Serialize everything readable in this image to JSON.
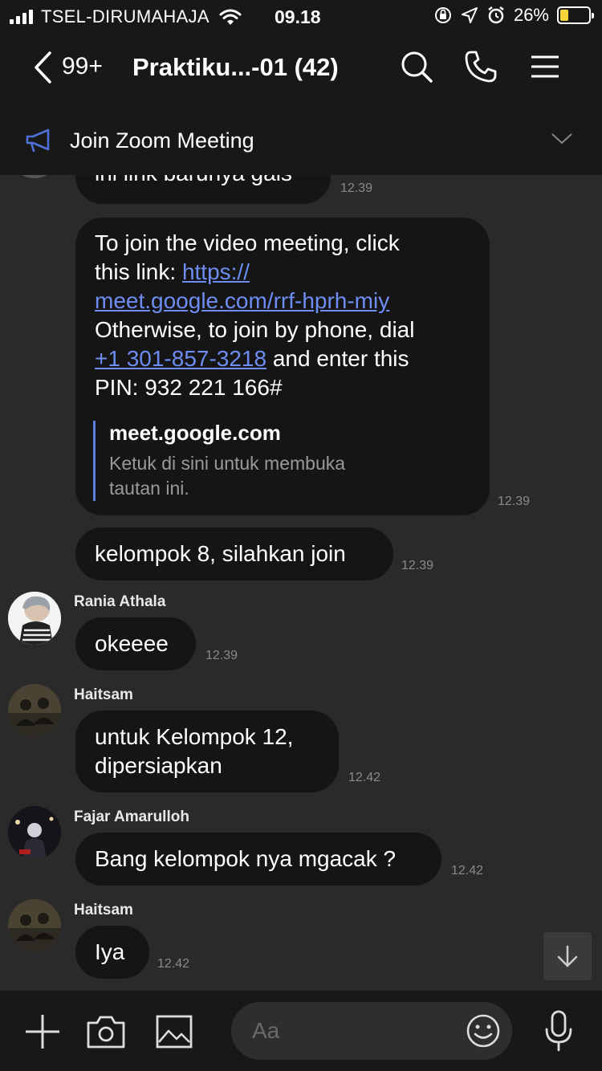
{
  "status_bar": {
    "carrier": "TSEL-DIRUMAHAJA",
    "time": "09.18",
    "battery": "26%"
  },
  "header": {
    "unread_count": "99+",
    "title": "Praktiku...-01 (42)"
  },
  "announcement": {
    "text": "Join Zoom Meeting"
  },
  "messages": [
    {
      "text": "ini link barunya gais",
      "time": "12.39"
    },
    {
      "line1": "To join the video meeting, click",
      "line2_prefix": "this link: ",
      "link1": "https://",
      "link2": "meet.google.com/rrf-hprh-miy",
      "line4": "Otherwise, to join by phone, dial",
      "phone": "+1 301-857-3218",
      "line5_suffix": " and enter this",
      "line6": "PIN: 932 221 166#",
      "preview_domain": "meet.google.com",
      "preview_desc_1": "Ketuk di sini untuk membuka",
      "preview_desc_2": "tautan ini.",
      "time": "12.39"
    },
    {
      "text": "kelompok 8, silahkan join",
      "time": "12.39"
    },
    {
      "sender": "Rania Athala",
      "text": "okeeee",
      "time": "12.39"
    },
    {
      "sender": "Haitsam",
      "line1": "untuk Kelompok 12,",
      "line2": "dipersiapkan",
      "time": "12.42"
    },
    {
      "sender": "Fajar Amarulloh",
      "text": "Bang kelompok nya mgacak ?",
      "time": "12.42"
    },
    {
      "sender": "Haitsam",
      "text": "Iya",
      "time": "12.42"
    }
  ],
  "composer": {
    "placeholder": "Aa"
  },
  "colors": {
    "background": "#2a2a2a",
    "bar": "#181818",
    "bubble": "#151515",
    "link": "#6e8df2",
    "accent": "#5b7fe0"
  }
}
